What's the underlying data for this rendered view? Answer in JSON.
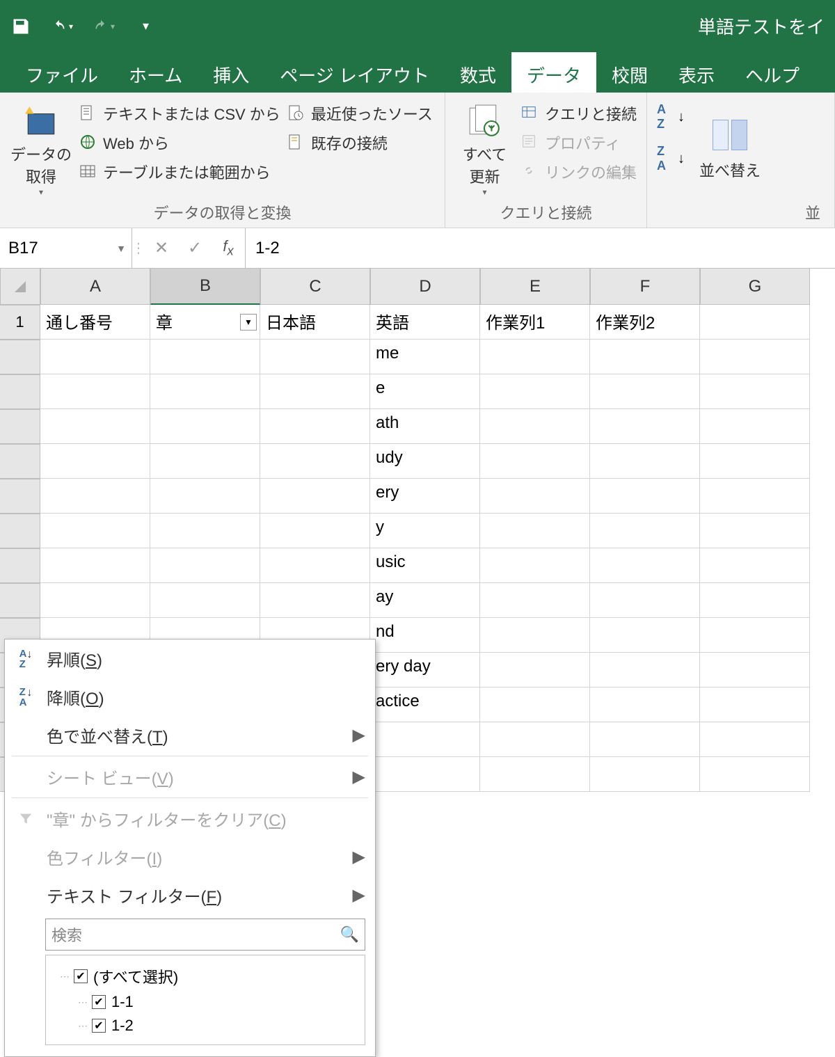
{
  "app_title": "単語テストをイ",
  "tabs": [
    "ファイル",
    "ホーム",
    "挿入",
    "ページ レイアウト",
    "数式",
    "データ",
    "校閲",
    "表示",
    "ヘルプ"
  ],
  "active_tab": "データ",
  "ribbon": {
    "group1": {
      "big": "データの\n取得",
      "cmds": [
        "テキストまたは CSV から",
        "Web から",
        "テーブルまたは範囲から"
      ],
      "right_cmds": [
        "最近使ったソース",
        "既存の接続"
      ],
      "label": "データの取得と変換"
    },
    "group2": {
      "big": "すべて\n更新",
      "cmds": [
        "クエリと接続",
        "プロパティ",
        "リンクの編集"
      ],
      "label": "クエリと接続"
    },
    "group3": {
      "sort": "並べ替え",
      "label": "並"
    }
  },
  "name_box": "B17",
  "formula_value": "1-2",
  "columns": [
    "A",
    "B",
    "C",
    "D",
    "E",
    "F",
    "G"
  ],
  "headers": [
    "通し番号",
    "章",
    "日本語",
    "英語",
    "作業列1",
    "作業列2",
    ""
  ],
  "d_values": [
    "me",
    "e",
    "ath",
    "udy",
    "ery",
    "y",
    "usic",
    "ay",
    "nd",
    "ery day",
    "actice"
  ],
  "filter_menu": {
    "asc": "昇順(",
    "asc_u": "S",
    "desc": "降順(",
    "desc_u": "O",
    "color_sort": "色で並べ替え(",
    "color_sort_u": "T",
    "sheet_view": "シート ビュー(",
    "sheet_view_u": "V",
    "clear": "\"章\" からフィルターをクリア(",
    "clear_u": "C",
    "color_filter": "色フィルター(",
    "color_filter_u": "I",
    "text_filter": "テキスト フィルター(",
    "text_filter_u": "F",
    "search_placeholder": "検索",
    "tree": [
      "(すべて選択)",
      "1-1",
      "1-2"
    ]
  }
}
